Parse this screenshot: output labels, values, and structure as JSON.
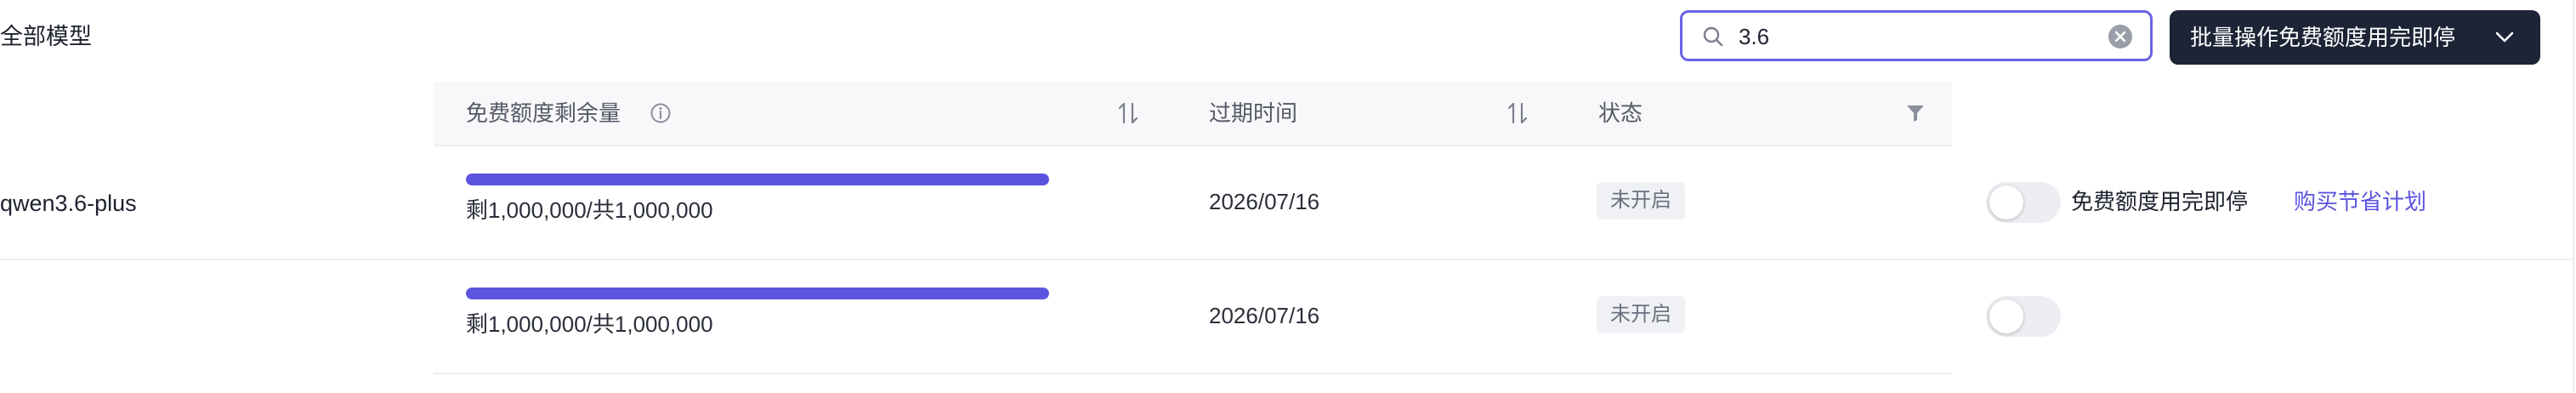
{
  "section": {
    "title": "全部模型"
  },
  "search": {
    "value": "3.6",
    "placeholder": ""
  },
  "batch_button": {
    "label": "批量操作免费额度用完即停"
  },
  "table": {
    "columns": {
      "quota": "免费额度剩余量",
      "expiry": "过期时间",
      "status": "状态"
    },
    "rows": [
      {
        "model": "qwen3.6-plus",
        "quota_text": "剩1,000,000/共1,000,000",
        "quota_fraction": 1.0,
        "expiry": "2026/07/16",
        "status": "未开启",
        "toggle_on": false,
        "toggle_label": "免费额度用完即停",
        "action_link": "购买节省计划"
      },
      {
        "model": "",
        "quota_text": "剩1,000,000/共1,000,000",
        "quota_fraction": 1.0,
        "expiry": "2026/07/16",
        "status": "未开启",
        "toggle_on": false
      }
    ]
  },
  "colors": {
    "accent": "#5b54e0",
    "button_dark": "#1c2436",
    "search_border": "#6a63e6"
  },
  "icons": [
    "search-icon",
    "clear-icon",
    "chevron-down-icon",
    "info-icon",
    "sort-icon",
    "filter-icon"
  ]
}
